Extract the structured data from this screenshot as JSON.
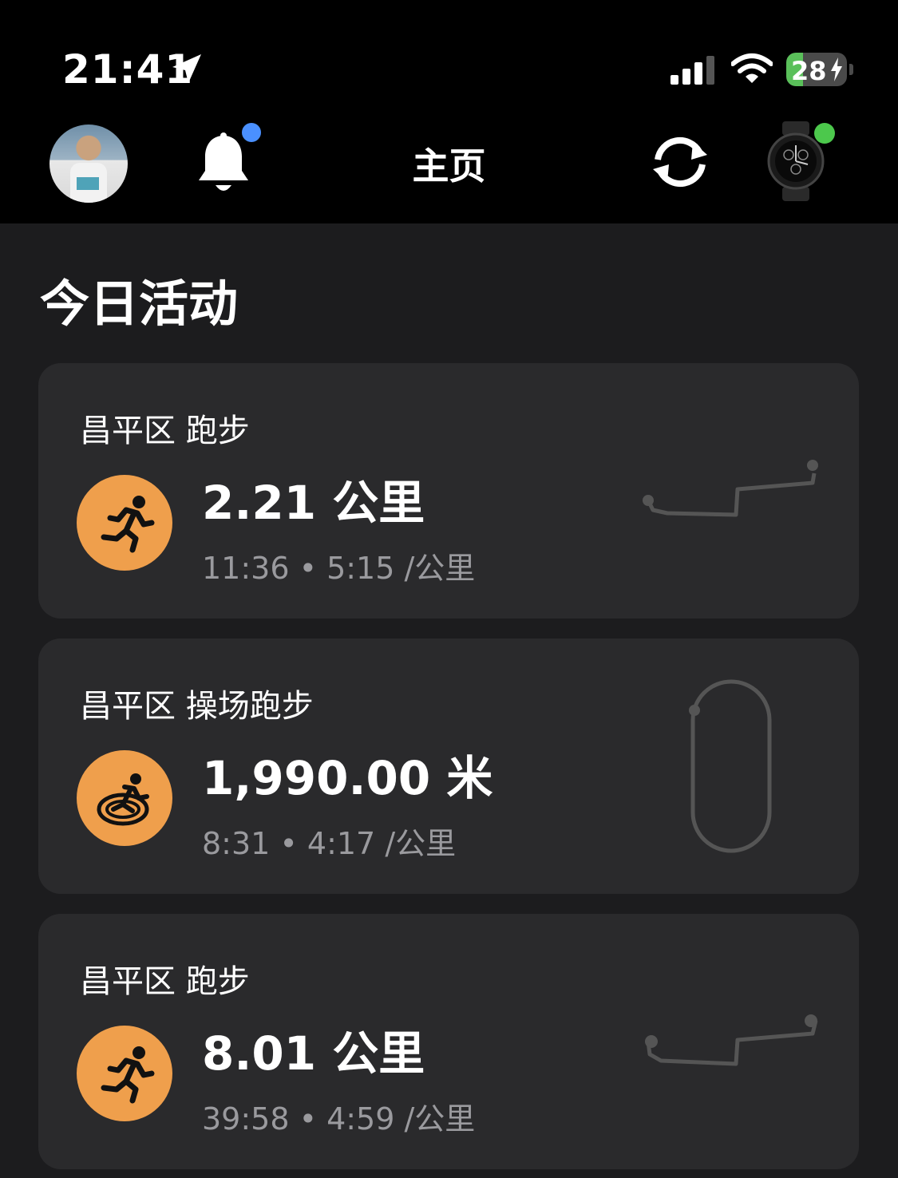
{
  "status_bar": {
    "time": "21:41",
    "battery": "28",
    "battery_level": 0.28,
    "icons": [
      "location-arrow-icon",
      "cellular-signal-icon",
      "wifi-icon",
      "battery-charging-icon"
    ]
  },
  "nav": {
    "title": "主页",
    "icons": [
      "avatar",
      "bell-icon",
      "sync-icon",
      "watch-icon"
    ]
  },
  "section": {
    "title": "今日活动"
  },
  "activities": [
    {
      "name": "昌平区 跑步",
      "value": "2.21 公里",
      "sub": "11:36 • 5:15 /公里",
      "icon": "running-icon"
    },
    {
      "name": "昌平区 操场跑步",
      "value": "1,990.00 米",
      "sub": "8:31 • 4:17 /公里",
      "icon": "track-running-icon"
    },
    {
      "name": "昌平区 跑步",
      "value": "8.01 公里",
      "sub": "39:58 • 4:59 /公里",
      "icon": "running-icon"
    }
  ],
  "colors": {
    "background": "#1c1c1e",
    "card": "#2a2a2c",
    "accent_orange": "#ef9f4c",
    "notification_blue": "#4a90ff",
    "connected_green": "#4cc84c",
    "subtext": "#9a9a9e"
  }
}
